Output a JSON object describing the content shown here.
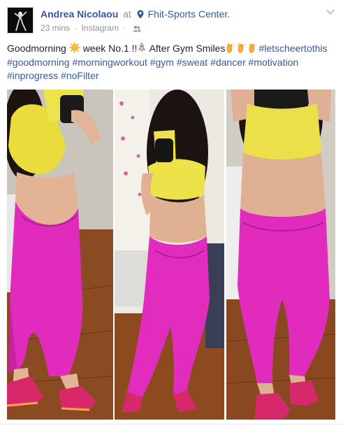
{
  "post": {
    "author_name": "Andrea Nicolaou",
    "at_word": "at",
    "place": "Fhit-Sports Center.",
    "time": "23 mins",
    "separator": "·",
    "source": "Instagram",
    "audience_icon": "friends-icon"
  },
  "message": {
    "line1_text_a": "Goodmorning",
    "line1_text_b": "week No.1 !!",
    "line1_text_c": "After Gym Smiles",
    "hashtags": [
      "#letscheertothis",
      "#goodmorning",
      "#morningworkout",
      "#gym",
      "#sweat",
      "#dancer",
      "#motivation",
      "#inprogress",
      "#noFilter"
    ],
    "emoji": {
      "sun": "sun-emoji",
      "rocket": "rocket-emoji",
      "clap": "clapping-hands-emoji"
    }
  },
  "photos": {
    "count": 3,
    "subject_top_color": "#f2e24a",
    "subject_pants_color": "#e62fc0",
    "floor_color": "#7a3b17"
  },
  "colors": {
    "link": "#365899",
    "meta": "#90949c",
    "text": "#1d2129"
  }
}
